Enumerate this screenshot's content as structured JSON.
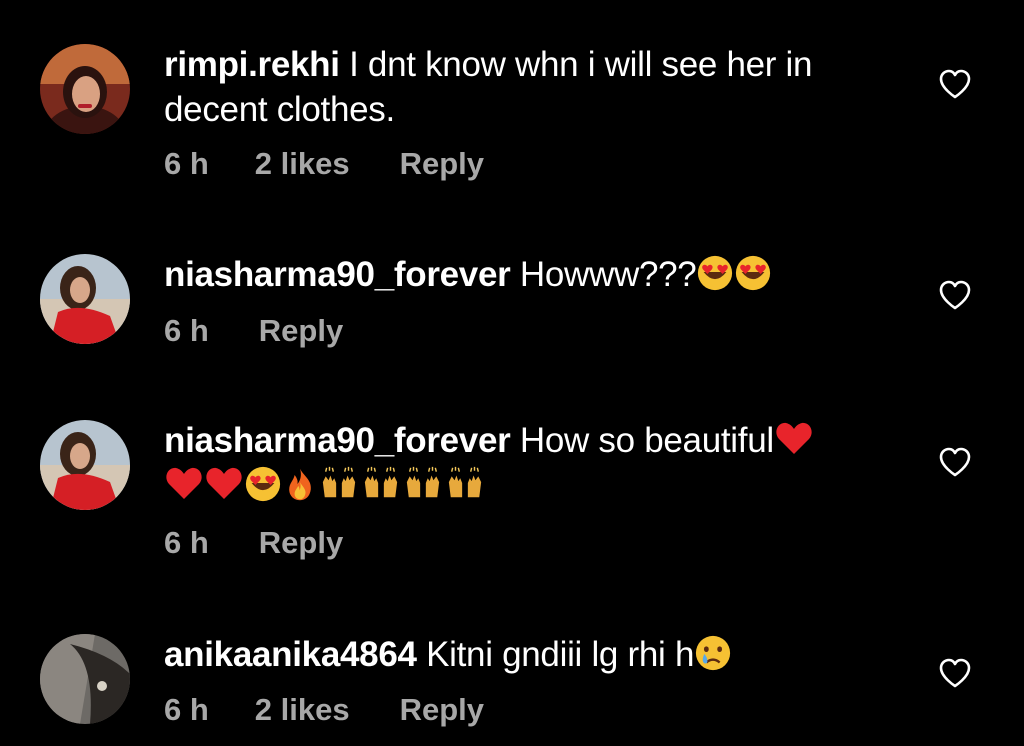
{
  "comments": [
    {
      "username": "rimpi.rekhi",
      "text": " I dnt know whn i will see her in decent clothes.",
      "time": "6 h",
      "likes": "2 likes",
      "reply": "Reply"
    },
    {
      "username": "niasharma90_forever",
      "text": " Howww???",
      "time": "6 h",
      "reply": "Reply",
      "emojis": [
        "heart-eyes-emoji",
        "heart-eyes-emoji"
      ]
    },
    {
      "username": "niasharma90_forever",
      "text": " How so beautiful",
      "time": "6 h",
      "reply": "Reply",
      "emojis": [
        "red-heart-emoji",
        "red-heart-emoji",
        "red-heart-emoji",
        "heart-eyes-emoji",
        "fire-emoji",
        "raising-hands-emoji",
        "raising-hands-emoji",
        "raising-hands-emoji",
        "raising-hands-emoji"
      ]
    },
    {
      "username": "anikaanika4864",
      "text": " Kitni gndiii lg rhi h",
      "time": "6 h",
      "likes": "2 likes",
      "reply": "Reply",
      "emojis": [
        "crying-face-emoji"
      ]
    }
  ],
  "colors": {
    "background": "#000000",
    "text": "#ffffff",
    "meta": "#a8a8a8",
    "heart_emoji": "#e8242b",
    "emoji_face": "#f5c032"
  },
  "icons": {
    "like": "heart-outline-icon"
  }
}
